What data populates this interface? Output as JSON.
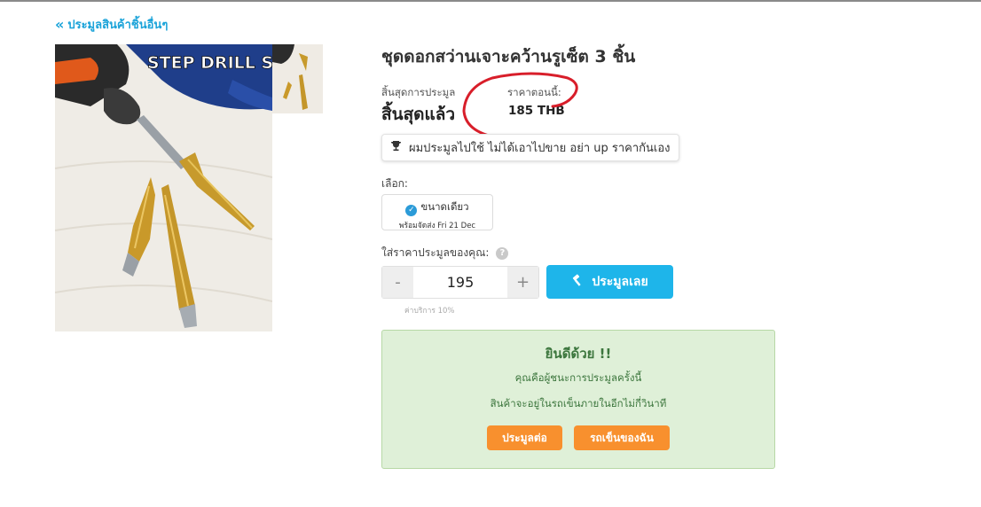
{
  "nav": {
    "back_label": "ประมูลสินค้าชิ้นอื่นๆ"
  },
  "product": {
    "image_text": "STEP DRILL SET",
    "title": "ชุดดอกสว่านเจาะคว้านรูเซ็ต 3 ชิ้น",
    "end_label": "สิ้นสุดการประมูล",
    "end_value": "สิ้นสุดแล้ว",
    "price_label": "ราคาตอนนี้:",
    "price_value": "185 THB",
    "notice": "ผมประมูลไปใช้ ไม่ได้เอาไปขาย อย่า up ราคากันเอง"
  },
  "options": {
    "label": "เลือก:",
    "selected": {
      "title": "ขนาดเดียว",
      "subtitle": "พร้อมจัดส่ง Fri 21 Dec"
    }
  },
  "bid": {
    "label": "ใส่ราคาประมูลของคุณ:",
    "help": "?",
    "minus": "-",
    "plus": "+",
    "value": "195",
    "fee": "ค่าบริการ 10%",
    "button": "ประมูลเลย"
  },
  "result": {
    "title": "ยินดีด้วย !!",
    "line1": "คุณคือผู้ชนะการประมูลครั้งนี้",
    "line2": "สินค้าจะอยู่ในรถเข็นภายในอีกไม่กี่วินาที",
    "continue_button": "ประมูลต่อ",
    "cart_button": "รถเข็นของฉัน"
  },
  "colors": {
    "accent": "#1eb5ea",
    "success_bg": "#dff0d8",
    "success_text": "#3c763d",
    "orange": "#f8902e",
    "annotation": "#d81e2a"
  }
}
